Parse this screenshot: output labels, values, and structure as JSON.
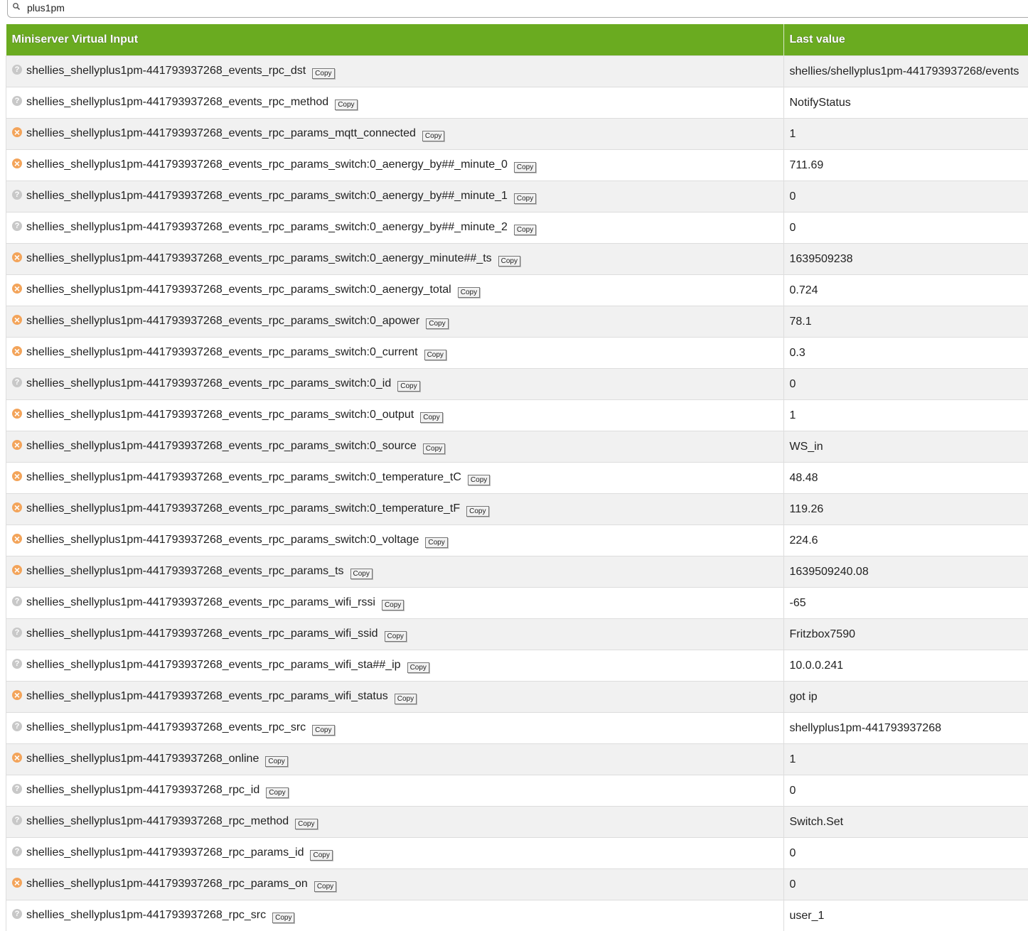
{
  "search": {
    "value": "plus1pm"
  },
  "table": {
    "headers": {
      "name": "Miniserver Virtual Input",
      "value": "Last value"
    },
    "copy_label": "Copy",
    "rows": [
      {
        "status": "q",
        "name": "shellies_shellyplus1pm-441793937268_events_rpc_dst",
        "value": "shellies/shellyplus1pm-441793937268/events"
      },
      {
        "status": "q",
        "name": "shellies_shellyplus1pm-441793937268_events_rpc_method",
        "value": "NotifyStatus"
      },
      {
        "status": "x",
        "name": "shellies_shellyplus1pm-441793937268_events_rpc_params_mqtt_connected",
        "value": "1"
      },
      {
        "status": "x",
        "name": "shellies_shellyplus1pm-441793937268_events_rpc_params_switch:0_aenergy_by##_minute_0",
        "value": "711.69"
      },
      {
        "status": "q",
        "name": "shellies_shellyplus1pm-441793937268_events_rpc_params_switch:0_aenergy_by##_minute_1",
        "value": "0"
      },
      {
        "status": "q",
        "name": "shellies_shellyplus1pm-441793937268_events_rpc_params_switch:0_aenergy_by##_minute_2",
        "value": "0"
      },
      {
        "status": "x",
        "name": "shellies_shellyplus1pm-441793937268_events_rpc_params_switch:0_aenergy_minute##_ts",
        "value": "1639509238"
      },
      {
        "status": "x",
        "name": "shellies_shellyplus1pm-441793937268_events_rpc_params_switch:0_aenergy_total",
        "value": "0.724"
      },
      {
        "status": "x",
        "name": "shellies_shellyplus1pm-441793937268_events_rpc_params_switch:0_apower",
        "value": "78.1"
      },
      {
        "status": "x",
        "name": "shellies_shellyplus1pm-441793937268_events_rpc_params_switch:0_current",
        "value": "0.3"
      },
      {
        "status": "q",
        "name": "shellies_shellyplus1pm-441793937268_events_rpc_params_switch:0_id",
        "value": "0"
      },
      {
        "status": "x",
        "name": "shellies_shellyplus1pm-441793937268_events_rpc_params_switch:0_output",
        "value": "1"
      },
      {
        "status": "x",
        "name": "shellies_shellyplus1pm-441793937268_events_rpc_params_switch:0_source",
        "value": "WS_in"
      },
      {
        "status": "x",
        "name": "shellies_shellyplus1pm-441793937268_events_rpc_params_switch:0_temperature_tC",
        "value": "48.48"
      },
      {
        "status": "x",
        "name": "shellies_shellyplus1pm-441793937268_events_rpc_params_switch:0_temperature_tF",
        "value": "119.26"
      },
      {
        "status": "x",
        "name": "shellies_shellyplus1pm-441793937268_events_rpc_params_switch:0_voltage",
        "value": "224.6"
      },
      {
        "status": "x",
        "name": "shellies_shellyplus1pm-441793937268_events_rpc_params_ts",
        "value": "1639509240.08"
      },
      {
        "status": "q",
        "name": "shellies_shellyplus1pm-441793937268_events_rpc_params_wifi_rssi",
        "value": "-65"
      },
      {
        "status": "q",
        "name": "shellies_shellyplus1pm-441793937268_events_rpc_params_wifi_ssid",
        "value": "Fritzbox7590"
      },
      {
        "status": "q",
        "name": "shellies_shellyplus1pm-441793937268_events_rpc_params_wifi_sta##_ip",
        "value": "10.0.0.241"
      },
      {
        "status": "x",
        "name": "shellies_shellyplus1pm-441793937268_events_rpc_params_wifi_status",
        "value": "got ip"
      },
      {
        "status": "q",
        "name": "shellies_shellyplus1pm-441793937268_events_rpc_src",
        "value": "shellyplus1pm-441793937268"
      },
      {
        "status": "x",
        "name": "shellies_shellyplus1pm-441793937268_online",
        "value": "1"
      },
      {
        "status": "q",
        "name": "shellies_shellyplus1pm-441793937268_rpc_id",
        "value": "0"
      },
      {
        "status": "q",
        "name": "shellies_shellyplus1pm-441793937268_rpc_method",
        "value": "Switch.Set"
      },
      {
        "status": "q",
        "name": "shellies_shellyplus1pm-441793937268_rpc_params_id",
        "value": "0"
      },
      {
        "status": "x",
        "name": "shellies_shellyplus1pm-441793937268_rpc_params_on",
        "value": "0"
      },
      {
        "status": "q",
        "name": "shellies_shellyplus1pm-441793937268_rpc_src",
        "value": "user_1"
      }
    ]
  },
  "colors": {
    "header": "#6aab20",
    "unknown": "#c8c8c8",
    "error": "#f3a45a"
  }
}
